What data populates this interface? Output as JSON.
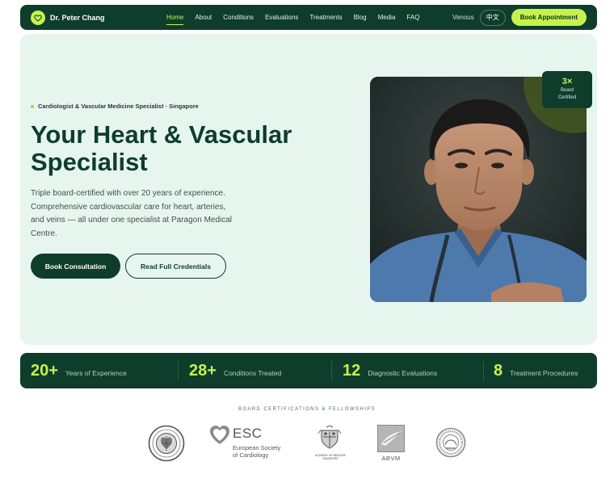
{
  "nav": {
    "brand": "Dr. Peter Chang",
    "menu": [
      {
        "label": "Home",
        "active": true
      },
      {
        "label": "About",
        "active": false
      },
      {
        "label": "Conditions",
        "active": false
      },
      {
        "label": "Evaluations",
        "active": false
      },
      {
        "label": "Treatments",
        "active": false
      },
      {
        "label": "Blog",
        "active": false
      },
      {
        "label": "Media",
        "active": false
      },
      {
        "label": "FAQ",
        "active": false
      }
    ],
    "venous": "Venous",
    "language": "中文",
    "book_button": "Book Appointment"
  },
  "hero": {
    "eyebrow": "Cardiologist & Vascular Medicine Specialist · Singapore",
    "title": "Your Heart & Vascular Specialist",
    "description": "Triple board-certified with over 20 years of experience. Comprehensive cardiovascular care for heart, arteries, and veins — all under one specialist at Paragon Medical Centre.",
    "primary_button": "Book Consultation",
    "secondary_button": "Read Full Credentials",
    "badge": {
      "number": "3×",
      "label_line1": "Board",
      "label_line2": "Certified"
    }
  },
  "stats": [
    {
      "value": "20+",
      "label": "Years of Experience"
    },
    {
      "value": "28+",
      "label": "Conditions Treated"
    },
    {
      "value": "12",
      "label": "Diagnostic Evaluations"
    },
    {
      "value": "8",
      "label": "Treatment Procedures"
    }
  ],
  "certifications": {
    "heading": "BOARD CERTIFICATIONS & FELLOWSHIPS",
    "esc_abbr": "ESC",
    "esc_line1": "European Society",
    "esc_line2": "of Cardiology",
    "ams_line1": "ACADEMY OF MEDICINE",
    "ams_line2": "SINGAPORE",
    "abvm": "ABVM"
  },
  "colors": {
    "nav_bg": "#0f3d2c",
    "accent": "#c6f24e",
    "hero_bg": "#e6f6ee"
  }
}
